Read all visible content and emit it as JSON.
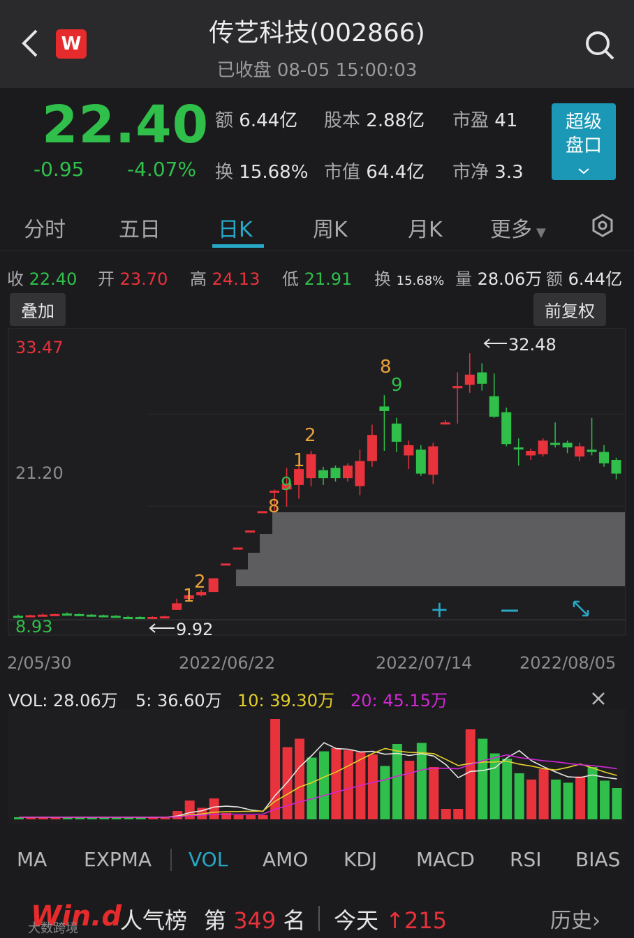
{
  "header": {
    "title": "传艺科技(002866)",
    "status": "已收盘 08-05 15:00:03",
    "logo_letter": "W"
  },
  "quote": {
    "price": "22.40",
    "change": "-0.95",
    "change_pct": "-4.07%",
    "stats": [
      {
        "label": "额",
        "value": "6.44亿"
      },
      {
        "label": "股本",
        "value": "2.88亿"
      },
      {
        "label": "市盈",
        "value": "41"
      },
      {
        "label": "换",
        "value": "15.68%"
      },
      {
        "label": "市值",
        "value": "64.4亿"
      },
      {
        "label": "市净",
        "value": "3.3"
      }
    ],
    "super_button": {
      "line1": "超级",
      "line2": "盘口"
    }
  },
  "tabs": [
    "分时",
    "五日",
    "日K",
    "周K",
    "月K",
    "更多"
  ],
  "active_tab": "日K",
  "ohlc": {
    "close_label": "收",
    "close": "22.40",
    "open_label": "开",
    "open": "23.70",
    "high_label": "高",
    "high": "24.13",
    "low_label": "低",
    "low": "21.91",
    "turnover_label": "换",
    "turnover": "15.68%",
    "vol_label": "量",
    "volume": "28.06万",
    "amount_label": "额",
    "amount": "6.44亿"
  },
  "chart_controls": {
    "overlay": "叠加",
    "adjust": "前复权"
  },
  "chart_data": {
    "type": "candlestick",
    "price_labels": {
      "top": "33.47",
      "mid": "21.20",
      "bottom": "8.93"
    },
    "annotations": {
      "low": "9.92",
      "high": "32.48"
    },
    "x_labels": [
      "2/05/30",
      "2022/06/22",
      "2022/07/14",
      "2022/08/05"
    ],
    "td_marks": [
      "1",
      "2",
      "8",
      "9",
      "1",
      "2",
      "8",
      "9"
    ],
    "candles": [
      {
        "o": 9.4,
        "c": 9.4,
        "h": 9.5,
        "l": 9.3,
        "up": false
      },
      {
        "o": 9.35,
        "c": 9.45,
        "h": 9.5,
        "l": 9.3,
        "up": true
      },
      {
        "o": 9.4,
        "c": 9.5,
        "h": 9.6,
        "l": 9.35,
        "up": true
      },
      {
        "o": 9.5,
        "c": 9.55,
        "h": 9.6,
        "l": 9.45,
        "up": true
      },
      {
        "o": 9.6,
        "c": 9.55,
        "h": 9.7,
        "l": 9.5,
        "up": false
      },
      {
        "o": 9.55,
        "c": 9.45,
        "h": 9.6,
        "l": 9.4,
        "up": false
      },
      {
        "o": 9.5,
        "c": 9.4,
        "h": 9.55,
        "l": 9.35,
        "up": false
      },
      {
        "o": 9.45,
        "c": 9.35,
        "h": 9.5,
        "l": 9.3,
        "up": false
      },
      {
        "o": 9.4,
        "c": 9.3,
        "h": 9.45,
        "l": 9.25,
        "up": false
      },
      {
        "o": 9.3,
        "c": 9.3,
        "h": 9.4,
        "l": 9.2,
        "up": false
      },
      {
        "o": 9.3,
        "c": 9.25,
        "h": 9.35,
        "l": 9.2,
        "up": false
      },
      {
        "o": 9.3,
        "c": 9.3,
        "h": 9.35,
        "l": 9.25,
        "up": true
      },
      {
        "o": 9.3,
        "c": 9.35,
        "h": 9.4,
        "l": 9.25,
        "up": true
      },
      {
        "o": 9.92,
        "c": 10.5,
        "h": 10.9,
        "l": 9.92,
        "up": true
      },
      {
        "o": 10.9,
        "c": 11.2,
        "h": 11.4,
        "l": 10.8,
        "up": true
      },
      {
        "o": 11.2,
        "c": 11.5,
        "h": 11.7,
        "l": 11.1,
        "up": true
      },
      {
        "o": 11.5,
        "c": 12.7,
        "h": 12.7,
        "l": 11.5,
        "up": true
      },
      {
        "o": 14.0,
        "c": 14.0,
        "h": 14.0,
        "l": 14.0,
        "up": true
      },
      {
        "o": 15.4,
        "c": 15.4,
        "h": 15.4,
        "l": 15.4,
        "up": true
      },
      {
        "o": 16.9,
        "c": 16.9,
        "h": 16.9,
        "l": 16.9,
        "up": true
      },
      {
        "o": 18.6,
        "c": 18.6,
        "h": 18.6,
        "l": 18.6,
        "up": true
      },
      {
        "o": 20.4,
        "c": 20.4,
        "h": 20.5,
        "l": 18.5,
        "up": true
      },
      {
        "o": 20.5,
        "c": 21.0,
        "h": 22.4,
        "l": 19.0,
        "up": true
      },
      {
        "o": 20.9,
        "c": 22.3,
        "h": 23.0,
        "l": 19.7,
        "up": true
      },
      {
        "o": 21.5,
        "c": 23.6,
        "h": 23.9,
        "l": 20.8,
        "up": true
      },
      {
        "o": 22.2,
        "c": 21.5,
        "h": 22.5,
        "l": 20.9,
        "up": false
      },
      {
        "o": 22.4,
        "c": 21.5,
        "h": 22.6,
        "l": 21.2,
        "up": false
      },
      {
        "o": 21.5,
        "c": 22.6,
        "h": 22.8,
        "l": 21.2,
        "up": true
      },
      {
        "o": 20.8,
        "c": 23.0,
        "h": 24.0,
        "l": 20.0,
        "up": true
      },
      {
        "o": 23.0,
        "c": 25.3,
        "h": 26.2,
        "l": 22.5,
        "up": true
      },
      {
        "o": 27.4,
        "c": 27.8,
        "h": 28.8,
        "l": 23.9,
        "up": false
      },
      {
        "o": 26.3,
        "c": 24.7,
        "h": 26.8,
        "l": 23.8,
        "up": false
      },
      {
        "o": 23.5,
        "c": 24.4,
        "h": 24.8,
        "l": 22.3,
        "up": true
      },
      {
        "o": 24.0,
        "c": 21.9,
        "h": 24.4,
        "l": 21.7,
        "up": false
      },
      {
        "o": 21.8,
        "c": 24.3,
        "h": 24.6,
        "l": 21.0,
        "up": true
      },
      {
        "o": 26.4,
        "c": 26.4,
        "h": 26.6,
        "l": 26.2,
        "up": true
      },
      {
        "o": 29.4,
        "c": 29.6,
        "h": 30.8,
        "l": 26.3,
        "up": true
      },
      {
        "o": 29.7,
        "c": 30.6,
        "h": 32.48,
        "l": 29.0,
        "up": true
      },
      {
        "o": 30.8,
        "c": 29.8,
        "h": 31.6,
        "l": 29.2,
        "up": false
      },
      {
        "o": 28.7,
        "c": 26.9,
        "h": 30.7,
        "l": 26.8,
        "up": false
      },
      {
        "o": 27.3,
        "c": 24.5,
        "h": 27.7,
        "l": 24.3,
        "up": false
      },
      {
        "o": 24.2,
        "c": 24.2,
        "h": 25.0,
        "l": 22.6,
        "up": false
      },
      {
        "o": 23.5,
        "c": 23.9,
        "h": 24.1,
        "l": 23.1,
        "up": true
      },
      {
        "o": 23.6,
        "c": 24.8,
        "h": 25.0,
        "l": 23.4,
        "up": true
      },
      {
        "o": 24.6,
        "c": 24.5,
        "h": 26.4,
        "l": 24.2,
        "up": false
      },
      {
        "o": 24.6,
        "c": 24.2,
        "h": 24.8,
        "l": 23.7,
        "up": false
      },
      {
        "o": 24.3,
        "c": 23.4,
        "h": 24.6,
        "l": 23.0,
        "up": true
      },
      {
        "o": 24.0,
        "c": 23.8,
        "h": 26.8,
        "l": 23.5,
        "up": false
      },
      {
        "o": 23.8,
        "c": 22.8,
        "h": 24.4,
        "l": 22.5,
        "up": false
      },
      {
        "o": 23.1,
        "c": 21.9,
        "h": 23.3,
        "l": 21.4,
        "up": false
      }
    ]
  },
  "vol_header": {
    "vol": "VOL: 28.06万",
    "ma5": "5: 36.60万",
    "ma10": "10: 39.30万",
    "ma20": "20: 45.15万"
  },
  "vol_colors": {
    "ma5": "#e6e6e6",
    "ma10": "#e3d02a",
    "ma20": "#d228d6"
  },
  "volume_bars": [
    {
      "v": 0.02,
      "up": false
    },
    {
      "v": 0.02,
      "up": true
    },
    {
      "v": 0.02,
      "up": true
    },
    {
      "v": 0.02,
      "up": true
    },
    {
      "v": 0.02,
      "up": false
    },
    {
      "v": 0.02,
      "up": false
    },
    {
      "v": 0.02,
      "up": false
    },
    {
      "v": 0.02,
      "up": false
    },
    {
      "v": 0.02,
      "up": false
    },
    {
      "v": 0.02,
      "up": false
    },
    {
      "v": 0.02,
      "up": false
    },
    {
      "v": 0.02,
      "up": true
    },
    {
      "v": 0.02,
      "up": true
    },
    {
      "v": 0.08,
      "up": true
    },
    {
      "v": 0.18,
      "up": true
    },
    {
      "v": 0.11,
      "up": true
    },
    {
      "v": 0.2,
      "up": true
    },
    {
      "v": 0.06,
      "up": true
    },
    {
      "v": 0.04,
      "up": true
    },
    {
      "v": 0.04,
      "up": true
    },
    {
      "v": 0.04,
      "up": true
    },
    {
      "v": 0.96,
      "up": true
    },
    {
      "v": 0.69,
      "up": true
    },
    {
      "v": 0.77,
      "up": true
    },
    {
      "v": 0.59,
      "up": false
    },
    {
      "v": 0.65,
      "up": false
    },
    {
      "v": 0.68,
      "up": true
    },
    {
      "v": 0.66,
      "up": true
    },
    {
      "v": 0.64,
      "up": true
    },
    {
      "v": 0.62,
      "up": true
    },
    {
      "v": 0.51,
      "up": false
    },
    {
      "v": 0.72,
      "up": false
    },
    {
      "v": 0.56,
      "up": true
    },
    {
      "v": 0.73,
      "up": false
    },
    {
      "v": 0.5,
      "up": true
    },
    {
      "v": 0.1,
      "up": true
    },
    {
      "v": 0.1,
      "up": true
    },
    {
      "v": 0.86,
      "up": true
    },
    {
      "v": 0.77,
      "up": false
    },
    {
      "v": 0.63,
      "up": false
    },
    {
      "v": 0.58,
      "up": false
    },
    {
      "v": 0.44,
      "up": false
    },
    {
      "v": 0.38,
      "up": true
    },
    {
      "v": 0.48,
      "up": true
    },
    {
      "v": 0.38,
      "up": false
    },
    {
      "v": 0.35,
      "up": false
    },
    {
      "v": 0.41,
      "up": true
    },
    {
      "v": 0.5,
      "up": false
    },
    {
      "v": 0.37,
      "up": false
    },
    {
      "v": 0.3,
      "up": false
    }
  ],
  "indicators": [
    "MA",
    "EXPMA",
    "VOL",
    "AMO",
    "KDJ",
    "MACD",
    "RSI",
    "BIAS"
  ],
  "active_indicator": "VOL",
  "bottom_bar": {
    "brand": "Win.d",
    "board": "人气榜",
    "rank_prefix": "第",
    "rank": "349",
    "rank_suffix": "名",
    "today_label": "今天",
    "today_change": "215",
    "history": "历史"
  },
  "watermark": "大数跨境",
  "colors": {
    "up": "#e8323c",
    "down": "#2fbf4a",
    "accent": "#27a8c7",
    "orange": "#e8a23a"
  }
}
